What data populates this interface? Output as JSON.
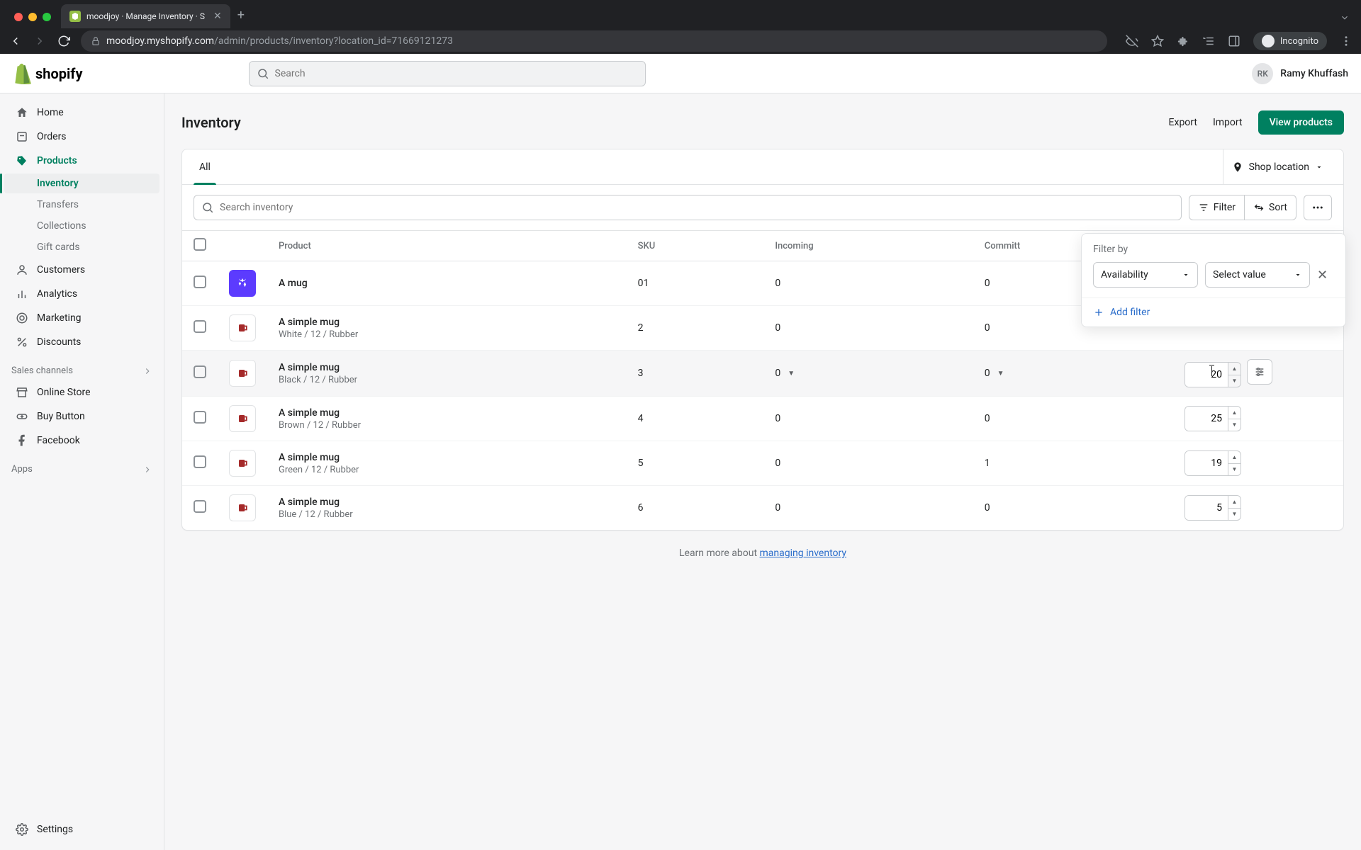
{
  "browser": {
    "tab_title": "moodjoy · Manage Inventory · S",
    "url_host": "moodjoy.myshopify.com",
    "url_path": "/admin/products/inventory?location_id=71669121273",
    "incognito": "Incognito"
  },
  "topbar": {
    "search_placeholder": "Search",
    "user_initials": "RK",
    "user_name": "Ramy Khuffash"
  },
  "sidebar": {
    "items": [
      {
        "label": "Home"
      },
      {
        "label": "Orders"
      },
      {
        "label": "Products"
      },
      {
        "label": "Customers"
      },
      {
        "label": "Analytics"
      },
      {
        "label": "Marketing"
      },
      {
        "label": "Discounts"
      }
    ],
    "product_children": [
      {
        "label": "Inventory"
      },
      {
        "label": "Transfers"
      },
      {
        "label": "Collections"
      },
      {
        "label": "Gift cards"
      }
    ],
    "sales_channels_label": "Sales channels",
    "channels": [
      {
        "label": "Online Store"
      },
      {
        "label": "Buy Button"
      },
      {
        "label": "Facebook"
      }
    ],
    "apps_label": "Apps",
    "settings": "Settings"
  },
  "page": {
    "title": "Inventory",
    "export": "Export",
    "import": "Import",
    "view_products": "View products",
    "tab_all": "All",
    "location": "Shop location",
    "search_placeholder": "Search inventory",
    "filter": "Filter",
    "sort": "Sort",
    "columns": {
      "product": "Product",
      "sku": "SKU",
      "incoming": "Incoming",
      "committed": "Committ"
    },
    "learn_prefix": "Learn more about ",
    "learn_link": "managing inventory"
  },
  "popover": {
    "title": "Filter by",
    "field": "Availability",
    "value": "Select value",
    "add_filter": "Add filter"
  },
  "rows": [
    {
      "name": "A mug",
      "variant": "",
      "sku": "01",
      "incoming": "0",
      "committed": "0",
      "available": "",
      "thumb": "purple"
    },
    {
      "name": "A simple mug",
      "variant": "White / 12 / Rubber",
      "sku": "2",
      "incoming": "0",
      "committed": "0",
      "available": "",
      "thumb": "red"
    },
    {
      "name": "A simple mug",
      "variant": "Black / 12 / Rubber",
      "sku": "3",
      "incoming": "0",
      "committed": "0",
      "available": "20",
      "thumb": "red"
    },
    {
      "name": "A simple mug",
      "variant": "Brown / 12 / Rubber",
      "sku": "4",
      "incoming": "0",
      "committed": "0",
      "available": "25",
      "thumb": "red"
    },
    {
      "name": "A simple mug",
      "variant": "Green / 12 / Rubber",
      "sku": "5",
      "incoming": "0",
      "committed": "1",
      "available": "19",
      "thumb": "red"
    },
    {
      "name": "A simple mug",
      "variant": "Blue / 12 / Rubber",
      "sku": "6",
      "incoming": "0",
      "committed": "0",
      "available": "5",
      "thumb": "red"
    }
  ]
}
